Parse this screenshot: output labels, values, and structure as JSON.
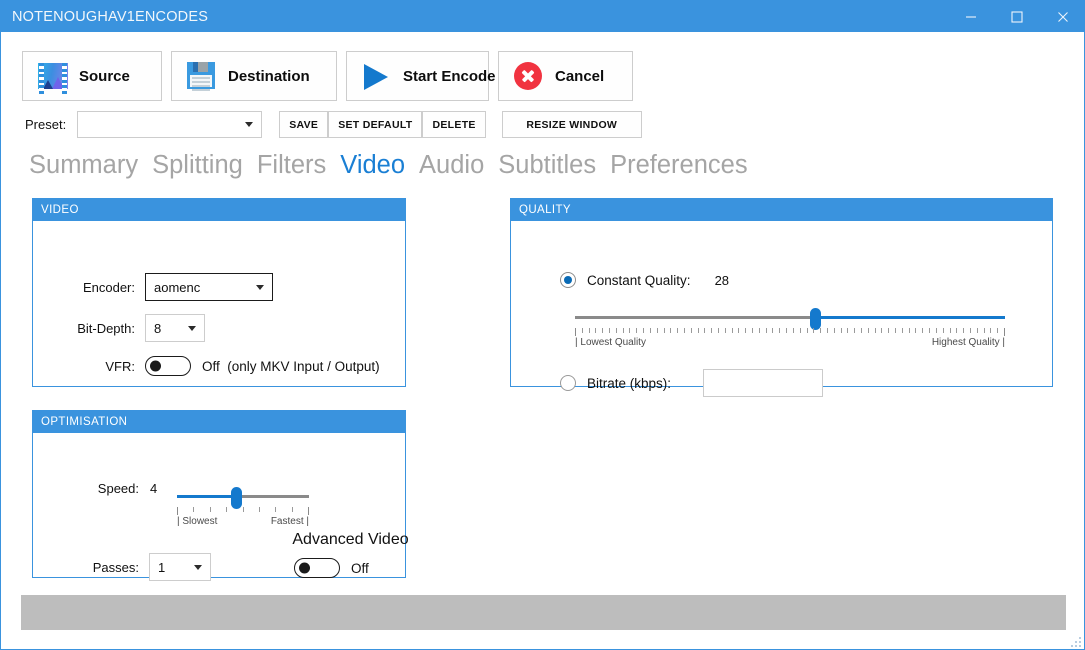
{
  "window": {
    "title": "NOTENOUGHAV1ENCODES",
    "accent_color": "#3a93de",
    "controls": {
      "minimize": "minimize-icon",
      "maximize": "maximize-icon",
      "close": "close-icon"
    }
  },
  "toolbar": {
    "buttons": [
      {
        "label": "Source",
        "icon": "film-photo-icon"
      },
      {
        "label": "Destination",
        "icon": "floppy-disk-icon"
      },
      {
        "label": "Start Encode",
        "icon": "play-icon"
      },
      {
        "label": "Cancel",
        "icon": "cancel-circle-icon"
      }
    ]
  },
  "preset": {
    "label": "Preset:",
    "value": "",
    "placeholder": "",
    "save_label": "SAVE",
    "set_default_label": "SET DEFAULT",
    "delete_label": "DELETE",
    "resize_window_label": "RESIZE WINDOW"
  },
  "tabs": {
    "active": "Video",
    "items": [
      {
        "label": "Summary"
      },
      {
        "label": "Splitting"
      },
      {
        "label": "Filters"
      },
      {
        "label": "Video"
      },
      {
        "label": "Audio"
      },
      {
        "label": "Subtitles"
      },
      {
        "label": "Preferences"
      }
    ]
  },
  "video_panel": {
    "title": "VIDEO",
    "encoder": {
      "label": "Encoder:",
      "value": "aomenc"
    },
    "bit_depth": {
      "label": "Bit-Depth:",
      "value": "8"
    },
    "vfr": {
      "label": "VFR:",
      "state": "Off",
      "state_label": "Off",
      "note": "(only MKV Input / Output)"
    }
  },
  "quality_panel": {
    "title": "QUALITY",
    "mode": "constant_quality",
    "constant_quality": {
      "label": "Constant Quality:",
      "value": "28",
      "selected": true,
      "slider": {
        "value": 28,
        "min": 0,
        "max": 63,
        "fill_percent": 56,
        "tick_count": 64,
        "left_end_label": "| Lowest Quality",
        "right_end_label": "Highest Quality |"
      }
    },
    "bitrate": {
      "label": "Bitrate (kbps):",
      "value": "",
      "placeholder": "",
      "selected": false
    }
  },
  "optimisation_panel": {
    "title": "OPTIMISATION",
    "speed": {
      "label": "Speed:",
      "value": "4",
      "slider": {
        "value": 4,
        "min": 0,
        "max": 8,
        "fill_percent": 45,
        "tick_count": 9,
        "left_end_label": "| Slowest",
        "right_end_label": "Fastest |"
      }
    },
    "passes": {
      "label": "Passes:",
      "value": "1"
    },
    "advanced_video": {
      "title": "Advanced Video",
      "state": "Off",
      "state_label": "Off"
    }
  },
  "status": {
    "progress_percent": 0,
    "progress_text": ""
  }
}
